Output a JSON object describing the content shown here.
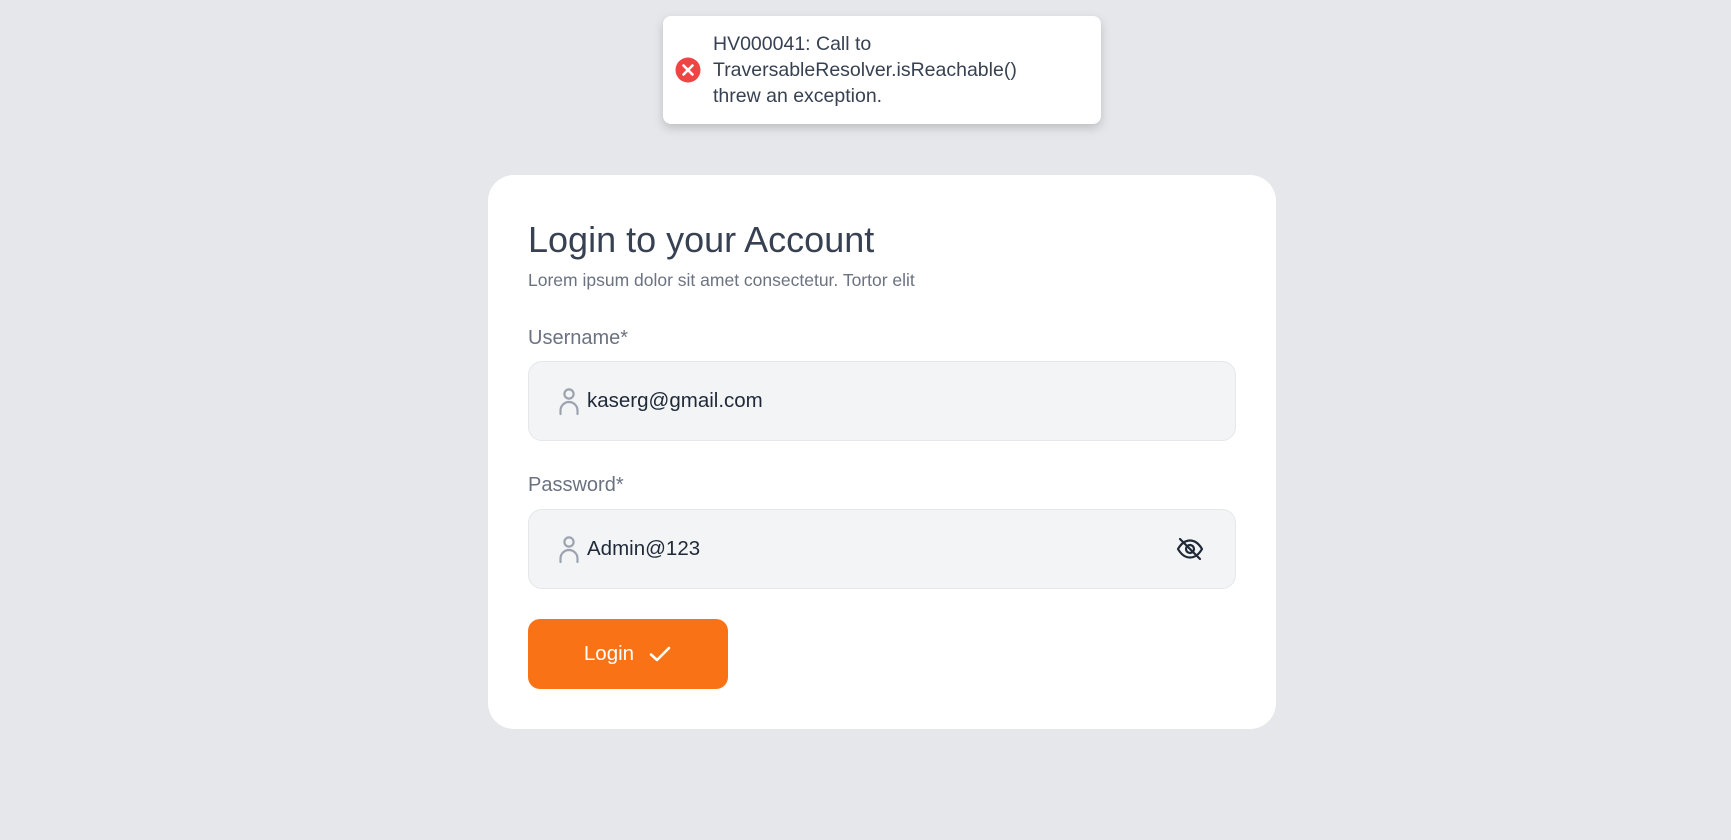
{
  "toast": {
    "type": "error",
    "icon": "error-circle-icon",
    "message": "HV000041: Call to\nTraversableResolver.isReachable()\nthrew an exception.",
    "icon_color": "#ef4444"
  },
  "login_card": {
    "title": "Login to your Account",
    "subtitle": "Lorem ipsum dolor sit amet consectetur. Tortor elit",
    "username": {
      "label": "Username*",
      "value": "kaserg@gmail.com",
      "icon": "user-icon"
    },
    "password": {
      "label": "Password*",
      "value": "Admin@123",
      "icon": "user-icon",
      "toggle_icon": "eye-off-icon"
    },
    "submit": {
      "label": "Login",
      "icon": "check-icon"
    }
  },
  "colors": {
    "background": "#e5e7eb",
    "accent": "#f97316",
    "error": "#ef4444",
    "text_primary": "#374151",
    "text_muted": "#6b7280"
  }
}
